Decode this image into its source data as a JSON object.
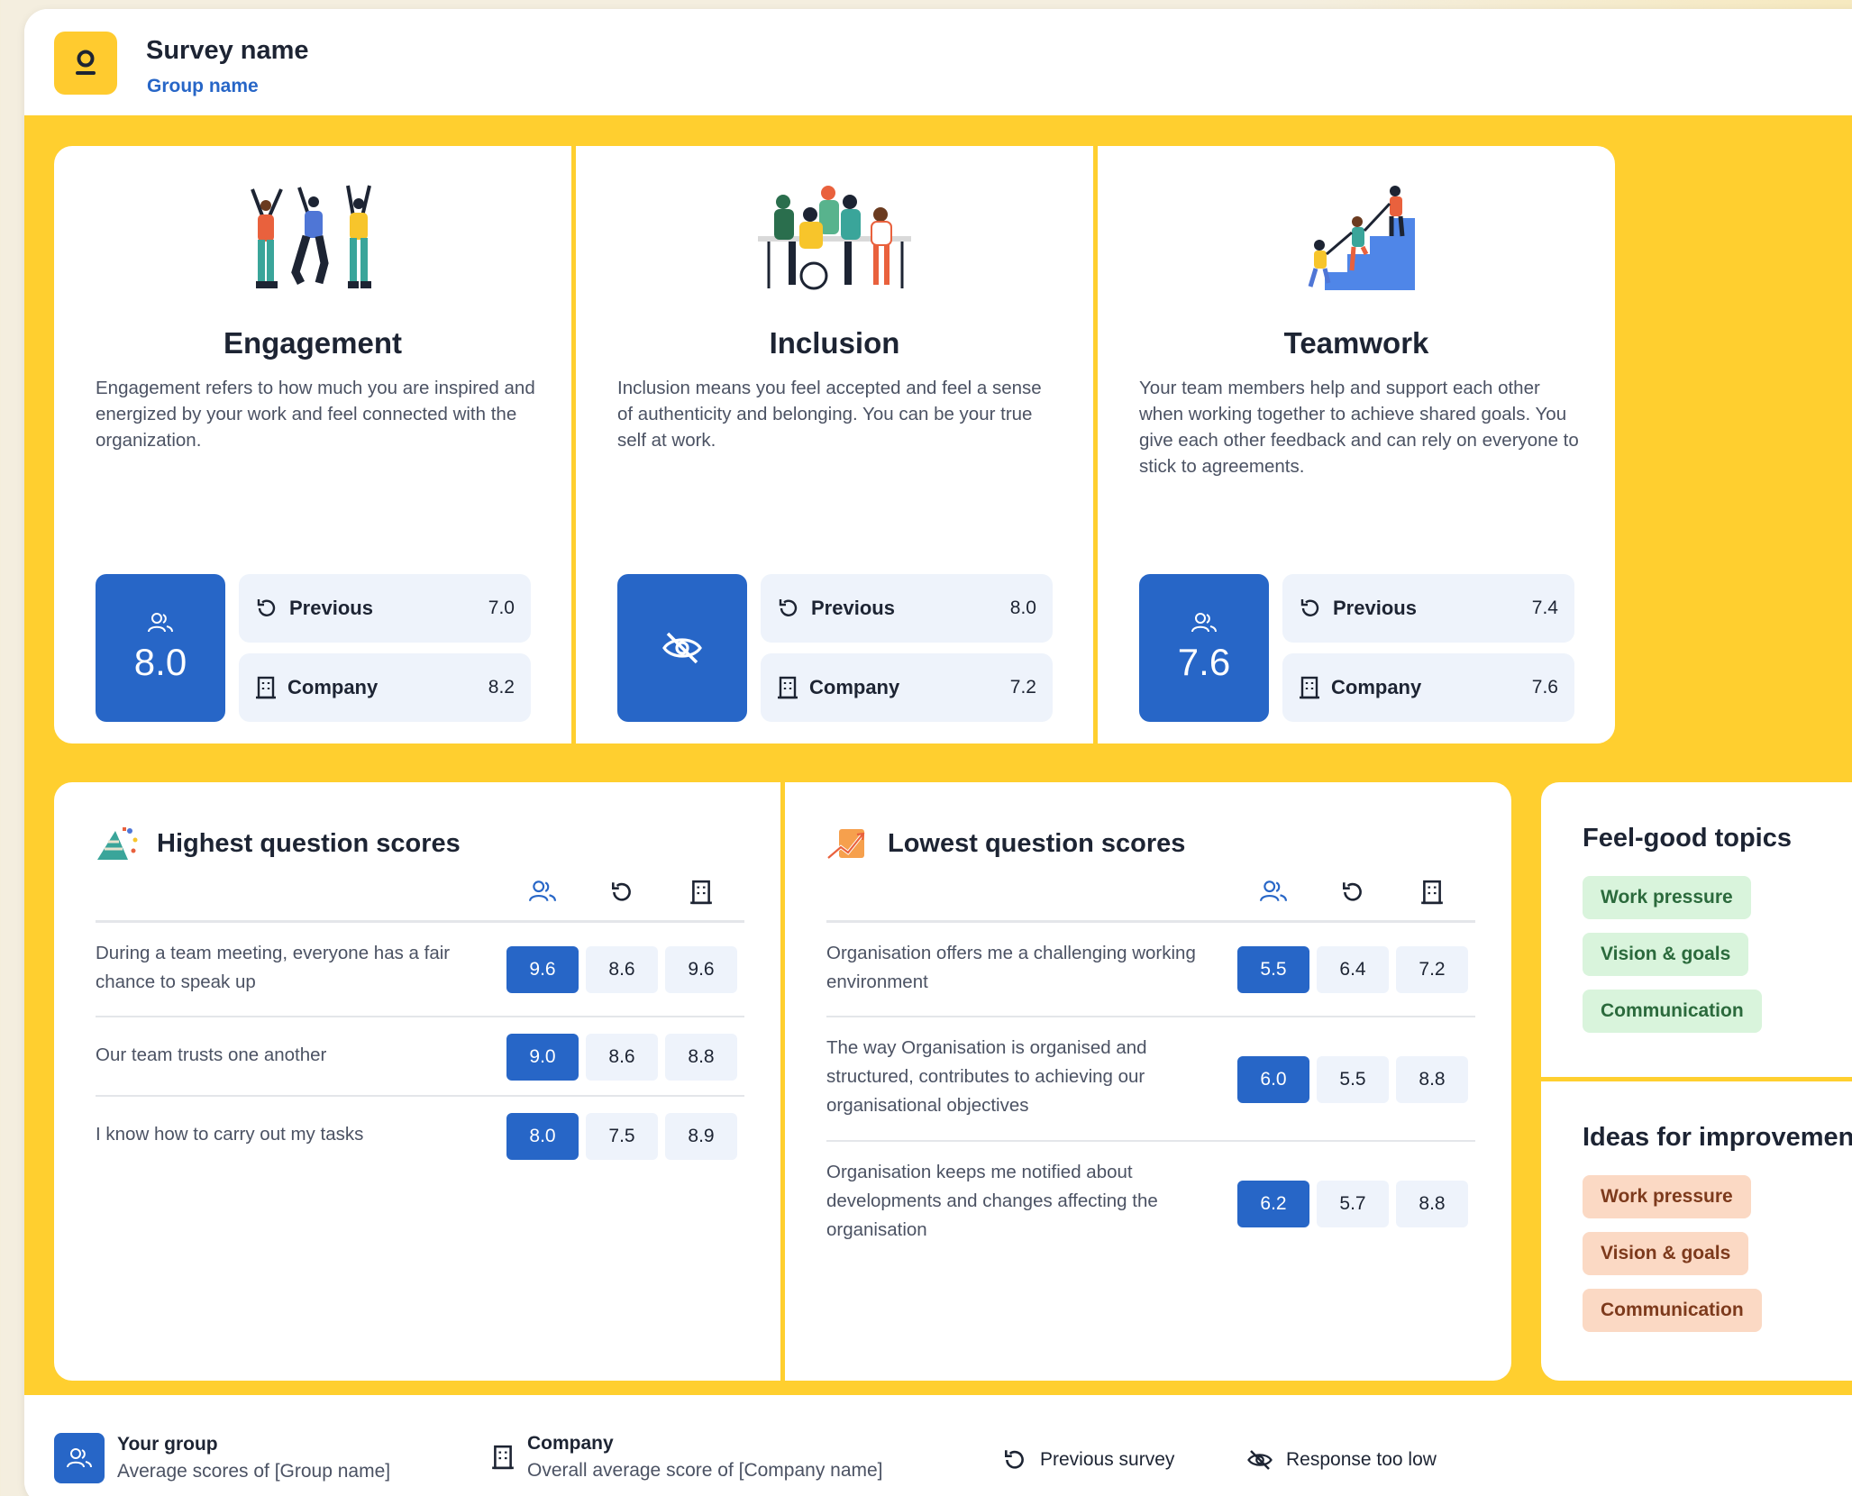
{
  "header": {
    "survey_name": "Survey name",
    "group_name": "Group name"
  },
  "topics": [
    {
      "title": "Engagement",
      "description": "Engagement refers to how much you are inspired and energized by your work and feel connected with the organization.",
      "score": "8.0",
      "score_hidden": false,
      "previous_label": "Previous",
      "previous": "7.0",
      "company_label": "Company",
      "company": "8.2"
    },
    {
      "title": "Inclusion",
      "description": "Inclusion means you feel accepted and feel a sense of authenticity and belonging. You can be your true self at work.",
      "score": "",
      "score_hidden": true,
      "previous_label": "Previous",
      "previous": "8.0",
      "company_label": "Company",
      "company": "7.2"
    },
    {
      "title": "Teamwork",
      "description": "Your team members help and support each other when working together to achieve shared goals. You give each other feedback and can rely on everyone to stick to agreements.",
      "score": "7.6",
      "score_hidden": false,
      "previous_label": "Previous",
      "previous": "7.4",
      "company_label": "Company",
      "company": "7.6"
    }
  ],
  "highest": {
    "title": "Highest question scores",
    "rows": [
      {
        "question": "During a team meeting, everyone has a fair chance to speak up",
        "group": "9.6",
        "previous": "8.6",
        "company": "9.6"
      },
      {
        "question": "Our team trusts one another",
        "group": "9.0",
        "previous": "8.6",
        "company": "8.8"
      },
      {
        "question": "I know how to carry out my tasks",
        "group": "8.0",
        "previous": "7.5",
        "company": "8.9"
      }
    ]
  },
  "lowest": {
    "title": "Lowest question scores",
    "rows": [
      {
        "question": "Organisation offers me a challenging working environment",
        "group": "5.5",
        "previous": "6.4",
        "company": "7.2"
      },
      {
        "question": "The way Organisation is organised and structured, contributes to achieving our organisational objectives",
        "group": "6.0",
        "previous": "5.5",
        "company": "8.8"
      },
      {
        "question": "Organisation keeps me notified about developments and changes affecting the organisation",
        "group": "6.2",
        "previous": "5.7",
        "company": "8.8"
      }
    ]
  },
  "feel_good": {
    "title": "Feel-good topics",
    "chips": [
      "Work pressure",
      "Vision & goals",
      "Communication"
    ]
  },
  "ideas": {
    "title": "Ideas for improvement",
    "chips": [
      "Work pressure",
      "Vision & goals",
      "Communication"
    ]
  },
  "legend": {
    "your_group": "Your group",
    "your_group_sub": "Average scores of [Group name]",
    "company": "Company",
    "company_sub": "Overall average score of [Company name]",
    "previous": "Previous survey",
    "response_low": "Response too low"
  },
  "colors": {
    "accent": "#2766c7",
    "board": "#ffcf2f",
    "good_chip": "#d9f4dc",
    "bad_chip": "#fbd9c4"
  },
  "icons": {
    "group": "people-icon",
    "previous": "history-icon",
    "company": "building-icon",
    "hidden": "eye-off-icon"
  }
}
